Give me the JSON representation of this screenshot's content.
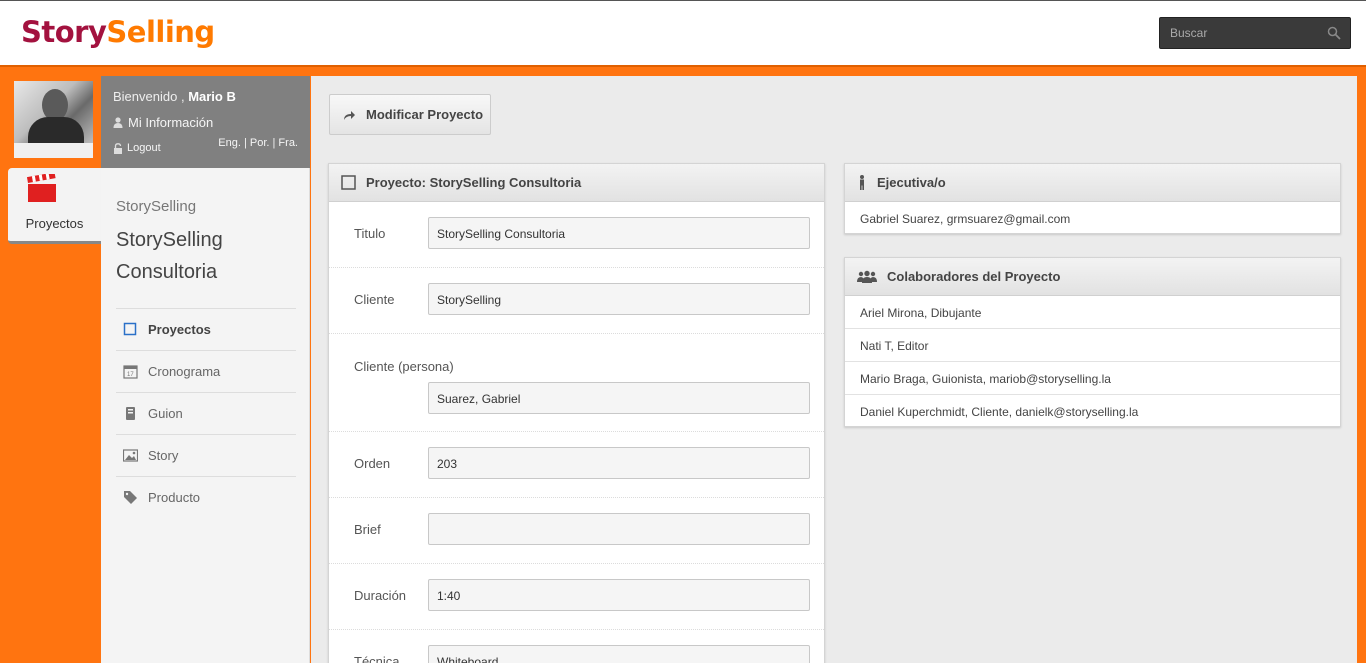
{
  "header": {
    "logo_story": "Story",
    "logo_selling": "Selling",
    "search_placeholder": "Buscar"
  },
  "rail": {
    "projects_tab": "Proyectos"
  },
  "user": {
    "welcome": "Bienvenido ,",
    "name": "Mario B",
    "my_info": "Mi Información",
    "logout": "Logout",
    "languages": "Eng. | Por. | Fra."
  },
  "sidebar": {
    "subtitle": "StorySelling",
    "title": "StorySelling Consultoria",
    "items": [
      {
        "label": "Proyectos",
        "icon": "square-icon"
      },
      {
        "label": "Cronograma",
        "icon": "calendar-icon"
      },
      {
        "label": "Guion",
        "icon": "script-icon"
      },
      {
        "label": "Story",
        "icon": "image-icon"
      },
      {
        "label": "Producto",
        "icon": "tag-icon"
      }
    ]
  },
  "toolbar": {
    "modify_label": "Modificar Proyecto"
  },
  "project": {
    "header": "Proyecto: StorySelling Consultoria",
    "fields": [
      {
        "label": "Titulo",
        "value": "StorySelling Consultoria"
      },
      {
        "label": "Cliente",
        "value": "StorySelling"
      },
      {
        "label": "Cliente (persona)",
        "value": "Suarez, Gabriel"
      },
      {
        "label": "Orden",
        "value": "203"
      },
      {
        "label": "Brief",
        "value": ""
      },
      {
        "label": "Duración",
        "value": "1:40"
      },
      {
        "label": "Técnica",
        "value": "Whiteboard"
      }
    ]
  },
  "executive": {
    "header": "Ejecutiva/o",
    "rows": [
      "Gabriel Suarez, grmsuarez@gmail.com"
    ]
  },
  "collaborators": {
    "header": "Colaboradores del Proyecto",
    "rows": [
      "Ariel Mirona, Dibujante",
      "Nati T, Editor",
      "Mario Braga, Guionista, mariob@storyselling.la",
      "Daniel Kuperchmidt, Cliente, danielk@storyselling.la"
    ]
  },
  "colors": {
    "accent": "#ff7410",
    "brand_story": "#a3123f",
    "brand_selling": "#ff7a00"
  }
}
